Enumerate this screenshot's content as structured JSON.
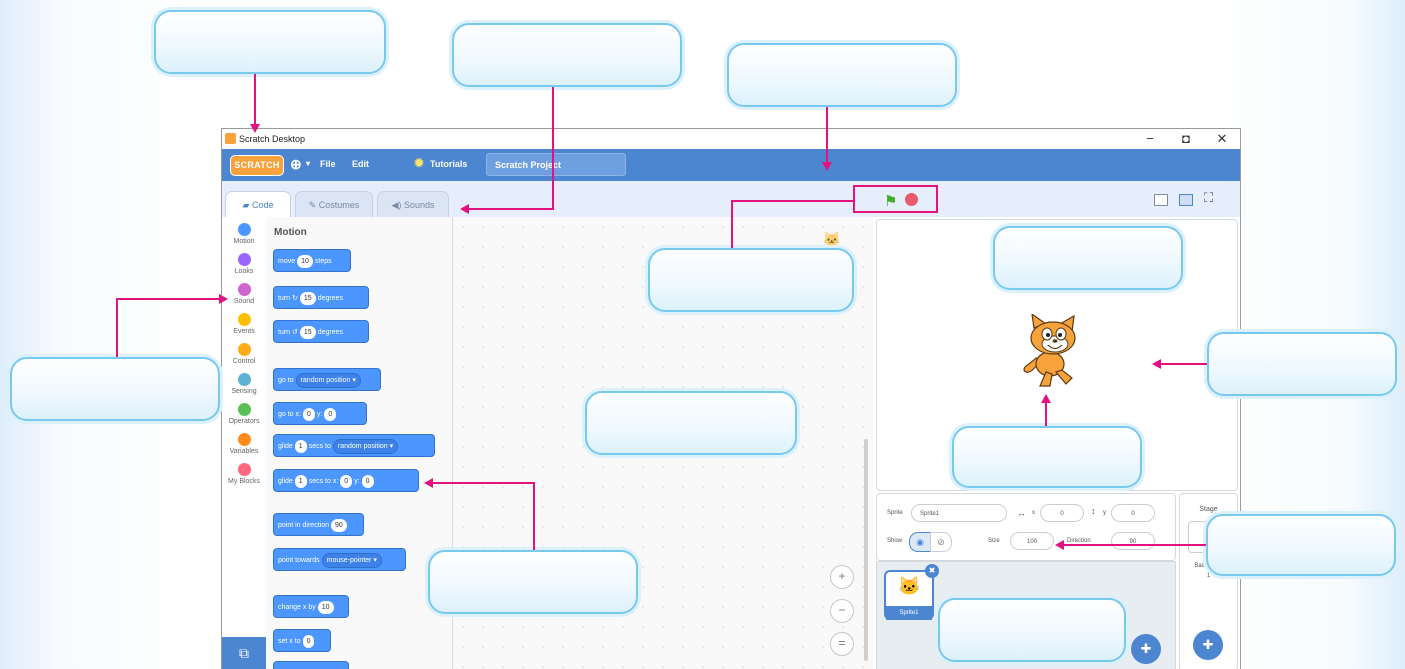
{
  "window": {
    "title": "Scratch Desktop",
    "controls": [
      "−",
      "◘",
      "✕"
    ]
  },
  "menubar": {
    "logo": "SCRATCH",
    "language_icon": "globe-icon",
    "items": [
      "File",
      "Edit"
    ],
    "tutorials": "Tutorials",
    "project_title": "Scratch Project"
  },
  "tabs": [
    {
      "label": "Code",
      "active": true
    },
    {
      "label": "Costumes",
      "active": false
    },
    {
      "label": "Sounds",
      "active": false
    }
  ],
  "categories": [
    {
      "label": "Motion",
      "color": "#4c97ff"
    },
    {
      "label": "Looks",
      "color": "#9966ff"
    },
    {
      "label": "Sound",
      "color": "#cf63cf"
    },
    {
      "label": "Events",
      "color": "#ffbf00"
    },
    {
      "label": "Control",
      "color": "#ffab19"
    },
    {
      "label": "Sensing",
      "color": "#5cb1d6"
    },
    {
      "label": "Operators",
      "color": "#59c059"
    },
    {
      "label": "Variables",
      "color": "#ff8c1a"
    },
    {
      "label": "My Blocks",
      "color": "#ff6680"
    }
  ],
  "palette": {
    "title": "Motion",
    "blocks": {
      "move": {
        "a": "move",
        "v": "10",
        "b": "steps"
      },
      "turn_right": {
        "a": "turn",
        "v": "15",
        "b": "degrees"
      },
      "turn_left": {
        "a": "turn",
        "v": "15",
        "b": "degrees"
      },
      "goto": {
        "a": "go to",
        "dd": "random position ▾"
      },
      "goto_xy": {
        "a": "go to x:",
        "x": "0",
        "m": "y:",
        "y": "0"
      },
      "glide_to": {
        "a": "glide",
        "v": "1",
        "m": "secs to",
        "dd": "random position ▾"
      },
      "glide_xy": {
        "a": "glide",
        "v": "1",
        "m": "secs to x:",
        "x": "0",
        "n": "y:",
        "y": "0"
      },
      "point_dir": {
        "a": "point in direction",
        "v": "90"
      },
      "point_towards": {
        "a": "point towards",
        "dd": "mouse-pointer ▾"
      },
      "change_x": {
        "a": "change x by",
        "v": "10"
      },
      "set_x": {
        "a": "set x to",
        "v": "0"
      }
    }
  },
  "zoom": {
    "in": "+",
    "out": "−",
    "reset": "="
  },
  "sprite_info": {
    "sprite_label": "Sprite",
    "sprite_name": "Sprite1",
    "x_label": "x",
    "x": "0",
    "y_label": "y",
    "y": "0",
    "show_label": "Show",
    "size_label": "Size",
    "size": "100",
    "direction_label": "Direction",
    "direction": "90"
  },
  "sprite_list": [
    {
      "name": "Sprite1"
    }
  ],
  "stage_panel": {
    "title": "Stage",
    "backdrops_label": "Backdrops",
    "backdrops_count": "1"
  }
}
